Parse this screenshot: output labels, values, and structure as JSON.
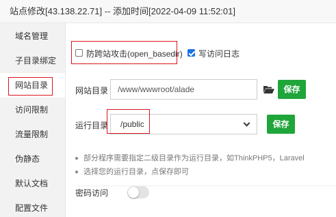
{
  "window": {
    "title": "站点修改[43.138.22.71] -- 添加时间[2022-04-09 11:52:01]"
  },
  "sidebar": {
    "items": [
      {
        "label": "域名管理"
      },
      {
        "label": "子目录绑定"
      },
      {
        "label": "网站目录",
        "active": true
      },
      {
        "label": "访问限制"
      },
      {
        "label": "流量限制"
      },
      {
        "label": "伪静态"
      },
      {
        "label": "默认文档"
      },
      {
        "label": "配置文件"
      }
    ]
  },
  "options": {
    "anti_xss_label": "防跨站攻击(open_basedir)",
    "anti_xss_checked": false,
    "access_log_label": "写访问日志",
    "access_log_checked": true
  },
  "site_dir": {
    "label": "网站目录",
    "value": "/www/wwwroot/alade",
    "save_label": "保存"
  },
  "run_dir": {
    "label": "运行目录",
    "selected": "/public",
    "save_label": "保存"
  },
  "notes": [
    "部分程序需要指定二级目录作为运行目录，如ThinkPHP5，Laravel",
    "选择您的运行目录，点保存即可"
  ],
  "password_access": {
    "label": "密码访问",
    "enabled": false
  },
  "colors": {
    "accent_green": "#20a53a",
    "highlight_red": "#d9141c",
    "checkbox_blue": "#1a73e8"
  }
}
